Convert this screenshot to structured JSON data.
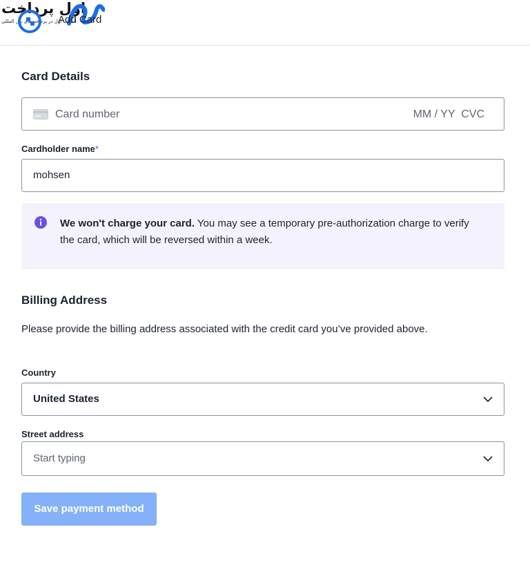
{
  "header": {
    "title": "Add Card",
    "logo": {
      "text": "اول پرداخت",
      "subtext": "انتخاب اول در پرداخت‌های بین المللی"
    }
  },
  "card_details": {
    "section_title": "Card Details",
    "card_number_placeholder": "Card number",
    "expiry_cvc_placeholder": "MM / YY  CVC"
  },
  "cardholder": {
    "label": "Cardholder name",
    "required_mark": "*",
    "value": "mohsen"
  },
  "info": {
    "bold": "We won't charge your card.",
    "text": " You may see a temporary pre-authorization charge to verify the card, which will be reversed within a week."
  },
  "billing": {
    "section_title": "Billing Address",
    "description": "Please provide the billing address associated with the credit card you’ve provided above.",
    "country_label": "Country",
    "country_value": "United States",
    "street_label": "Street address",
    "street_placeholder": "Start typing"
  },
  "actions": {
    "save_label": "Save payment method"
  },
  "colors": {
    "accent": "#3d6ef0",
    "button_disabled": "#84b1f7",
    "info_bg": "#f4f3fd",
    "info_icon": "#6b4ee6",
    "logo_blue": "#1a6fe8"
  }
}
